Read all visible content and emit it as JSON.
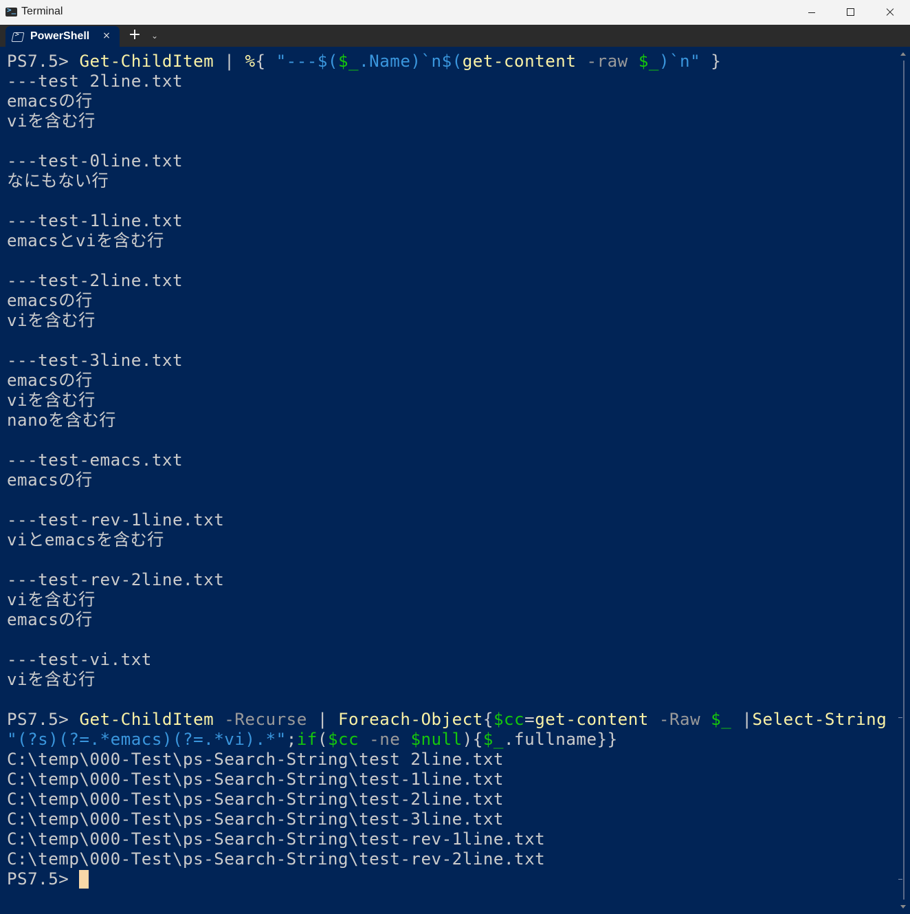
{
  "window": {
    "title": "Terminal",
    "controls": {
      "minimize": "minimize",
      "maximize": "maximize",
      "close": "close"
    }
  },
  "tabs": [
    {
      "label": "PowerShell",
      "icon": "powershell-icon",
      "close": "×"
    }
  ],
  "tabbar": {
    "new_tab": "+",
    "dropdown": "⌄"
  },
  "colors": {
    "background": "#012456",
    "command": "#f9f1a5",
    "parameter": "#9a9a9a",
    "string": "#3a96dd",
    "variable": "#16c60c",
    "text": "#cccccc",
    "cursor": "#f9d7a8"
  },
  "console": {
    "lines": [
      [
        {
          "t": "PS7.5> ",
          "c": "prompt"
        },
        {
          "t": "Get-ChildItem",
          "c": "cmd"
        },
        {
          "t": " | ",
          "c": "op"
        },
        {
          "t": "%",
          "c": "cmd"
        },
        {
          "t": "{ ",
          "c": "op"
        },
        {
          "t": "\"---$(",
          "c": "str"
        },
        {
          "t": "$_",
          "c": "var"
        },
        {
          "t": ".Name)`n$(",
          "c": "str"
        },
        {
          "t": "get-content",
          "c": "cmd"
        },
        {
          "t": " -raw ",
          "c": "param"
        },
        {
          "t": "$_",
          "c": "var"
        },
        {
          "t": ")`n\"",
          "c": "str"
        },
        {
          "t": " }",
          "c": "op"
        }
      ],
      [
        {
          "t": "---test 2line.txt",
          "c": "plain"
        }
      ],
      [
        {
          "t": "emacsの行",
          "c": "plain"
        }
      ],
      [
        {
          "t": "viを含む行",
          "c": "plain"
        }
      ],
      [
        {
          "t": "",
          "c": "plain"
        }
      ],
      [
        {
          "t": "---test-0line.txt",
          "c": "plain"
        }
      ],
      [
        {
          "t": "なにもない行",
          "c": "plain"
        }
      ],
      [
        {
          "t": "",
          "c": "plain"
        }
      ],
      [
        {
          "t": "---test-1line.txt",
          "c": "plain"
        }
      ],
      [
        {
          "t": "emacsとviを含む行",
          "c": "plain"
        }
      ],
      [
        {
          "t": "",
          "c": "plain"
        }
      ],
      [
        {
          "t": "---test-2line.txt",
          "c": "plain"
        }
      ],
      [
        {
          "t": "emacsの行",
          "c": "plain"
        }
      ],
      [
        {
          "t": "viを含む行",
          "c": "plain"
        }
      ],
      [
        {
          "t": "",
          "c": "plain"
        }
      ],
      [
        {
          "t": "---test-3line.txt",
          "c": "plain"
        }
      ],
      [
        {
          "t": "emacsの行",
          "c": "plain"
        }
      ],
      [
        {
          "t": "viを含む行",
          "c": "plain"
        }
      ],
      [
        {
          "t": "nanoを含む行",
          "c": "plain"
        }
      ],
      [
        {
          "t": "",
          "c": "plain"
        }
      ],
      [
        {
          "t": "---test-emacs.txt",
          "c": "plain"
        }
      ],
      [
        {
          "t": "emacsの行",
          "c": "plain"
        }
      ],
      [
        {
          "t": "",
          "c": "plain"
        }
      ],
      [
        {
          "t": "---test-rev-1line.txt",
          "c": "plain"
        }
      ],
      [
        {
          "t": "viとemacsを含む行",
          "c": "plain"
        }
      ],
      [
        {
          "t": "",
          "c": "plain"
        }
      ],
      [
        {
          "t": "---test-rev-2line.txt",
          "c": "plain"
        }
      ],
      [
        {
          "t": "viを含む行",
          "c": "plain"
        }
      ],
      [
        {
          "t": "emacsの行",
          "c": "plain"
        }
      ],
      [
        {
          "t": "",
          "c": "plain"
        }
      ],
      [
        {
          "t": "---test-vi.txt",
          "c": "plain"
        }
      ],
      [
        {
          "t": "viを含む行",
          "c": "plain"
        }
      ],
      [
        {
          "t": "",
          "c": "plain"
        }
      ],
      [
        {
          "t": "PS7.5> ",
          "c": "prompt"
        },
        {
          "t": "Get-ChildItem",
          "c": "cmd"
        },
        {
          "t": " -Recurse",
          "c": "param"
        },
        {
          "t": " | ",
          "c": "op"
        },
        {
          "t": "Foreach-Object",
          "c": "cmd"
        },
        {
          "t": "{",
          "c": "op"
        },
        {
          "t": "$cc",
          "c": "var"
        },
        {
          "t": "=",
          "c": "op"
        },
        {
          "t": "get-content",
          "c": "cmd"
        },
        {
          "t": " -Raw ",
          "c": "param"
        },
        {
          "t": "$_",
          "c": "var"
        },
        {
          "t": " |",
          "c": "op"
        },
        {
          "t": "Select-String",
          "c": "cmd"
        }
      ],
      [
        {
          "t": "\"(?s)(?=.*emacs)(?=.*vi).*\"",
          "c": "str"
        },
        {
          "t": ";",
          "c": "op"
        },
        {
          "t": "if",
          "c": "var"
        },
        {
          "t": "(",
          "c": "op"
        },
        {
          "t": "$cc",
          "c": "var"
        },
        {
          "t": " -ne ",
          "c": "param"
        },
        {
          "t": "$null",
          "c": "var"
        },
        {
          "t": "){",
          "c": "op"
        },
        {
          "t": "$_",
          "c": "var"
        },
        {
          "t": ".fullname}}",
          "c": "op"
        }
      ],
      [
        {
          "t": "C:\\temp\\000-Test\\ps-Search-String\\test 2line.txt",
          "c": "plain"
        }
      ],
      [
        {
          "t": "C:\\temp\\000-Test\\ps-Search-String\\test-1line.txt",
          "c": "plain"
        }
      ],
      [
        {
          "t": "C:\\temp\\000-Test\\ps-Search-String\\test-2line.txt",
          "c": "plain"
        }
      ],
      [
        {
          "t": "C:\\temp\\000-Test\\ps-Search-String\\test-3line.txt",
          "c": "plain"
        }
      ],
      [
        {
          "t": "C:\\temp\\000-Test\\ps-Search-String\\test-rev-1line.txt",
          "c": "plain"
        }
      ],
      [
        {
          "t": "C:\\temp\\000-Test\\ps-Search-String\\test-rev-2line.txt",
          "c": "plain"
        }
      ],
      [
        {
          "t": "PS7.5> ",
          "c": "prompt"
        }
      ]
    ],
    "cursor_on_last_line": true
  }
}
